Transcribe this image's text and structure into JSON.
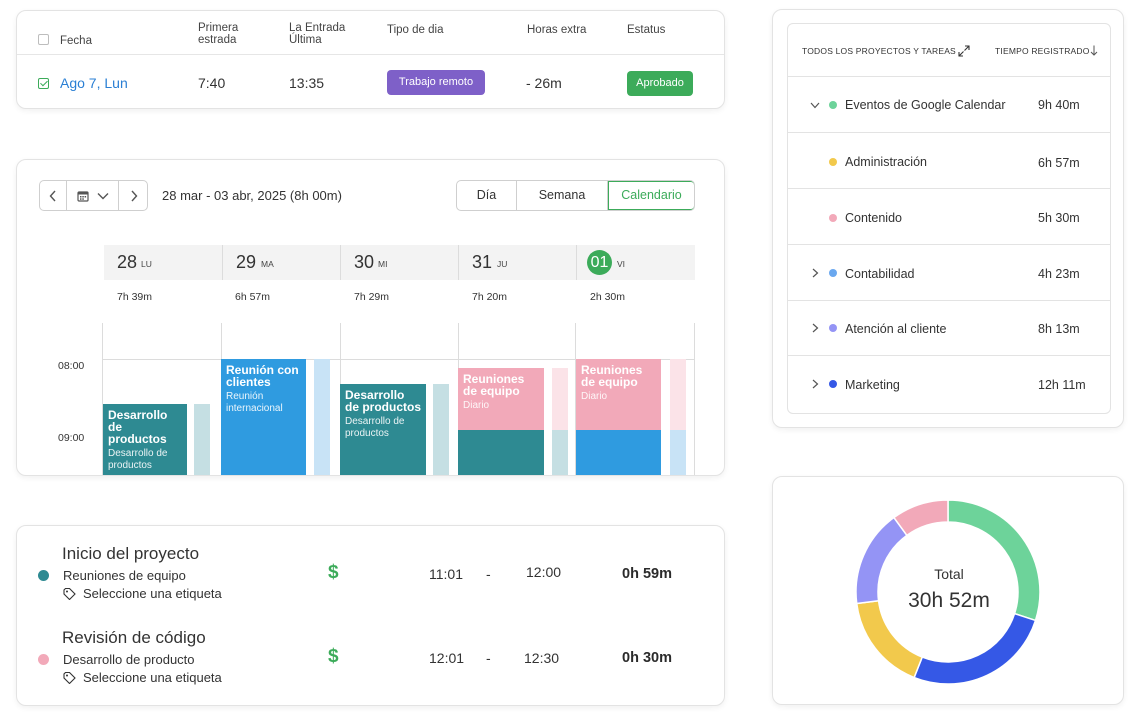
{
  "timesheet": {
    "headers": {
      "date": "Fecha",
      "first_entry_l1": "Primera",
      "first_entry_l2": "estrada",
      "last_entry_l1": "La Entrada",
      "last_entry_l2": "Última",
      "day_type": "Tipo de dia",
      "overtime": "Horas extra",
      "status": "Estatus"
    },
    "row": {
      "date": "Ago 7, Lun",
      "first_entry": "7:40",
      "last_entry": "13:35",
      "day_type": "Trabajo remoto",
      "overtime": "- 26m",
      "status": "Aprobado"
    },
    "colors": {
      "day_type": "#7e60c8",
      "status": "#3cab5a",
      "date_link": "#2a7fd4"
    }
  },
  "calendar": {
    "range": "28 mar - 03 abr, 2025 (8h 00m)",
    "icons": {
      "prev": "chevron-left-icon",
      "calendar": "calendar-icon",
      "dropdown": "chevron-down-icon",
      "next": "chevron-right-icon"
    },
    "views": [
      "Día",
      "Semana",
      "Calendario"
    ],
    "active_view": "Calendario",
    "time_labels": [
      "08:00",
      "09:00"
    ],
    "days": [
      {
        "num": "28",
        "abbr": "LU",
        "total": "7h 39m"
      },
      {
        "num": "29",
        "abbr": "MA",
        "total": "6h 57m"
      },
      {
        "num": "30",
        "abbr": "MI",
        "total": "7h 29m"
      },
      {
        "num": "31",
        "abbr": "JU",
        "total": "7h 20m"
      },
      {
        "num": "01",
        "abbr": "VI",
        "total": "2h 30m",
        "today": true
      }
    ],
    "events": [
      {
        "title": "Desarrollo de productos",
        "sub": "Desarrollo de productos"
      },
      {
        "title": "Reunión con clientes",
        "sub": "Reunión internacional"
      },
      {
        "title": "Desarrollo de productos",
        "sub": "Desarrollo de productos"
      },
      {
        "title": "Reuniones de equipo",
        "sub": "Diario"
      },
      {
        "title": "Reuniones de equipo",
        "sub": "Diario"
      }
    ],
    "colors": {
      "teal": "#2e8a92",
      "blue": "#2f9be0",
      "pink": "#f2a9b9",
      "today": "#3cab5a"
    }
  },
  "entries": [
    {
      "title": "Inicio del proyecto",
      "project": "Reuniones de equipo",
      "tag": "Seleccione una etiqueta",
      "start": "11:01",
      "sep": "-",
      "end": "12:00",
      "duration": "0h 59m",
      "dot_color": "#2e8a92",
      "billable": "$"
    },
    {
      "title": "Revisión de código",
      "project": "Desarrollo de producto",
      "tag": "Seleccione una etiqueta",
      "start": "12:01",
      "sep": "-",
      "end": "12:30",
      "duration": "0h 30m",
      "dot_color": "#f2a9b9",
      "billable": "$"
    }
  ],
  "projects": {
    "header_left": "TODOS LOS PROYECTOS Y TAREAS",
    "header_right": "TIEMPO REGISTRADO",
    "header_right_icon": "arrow-down-icon",
    "expand_icon": "expand-icon",
    "rows": [
      {
        "name": "Eventos de Google Calendar",
        "time": "9h 40m",
        "color": "#6dd39a",
        "chevron": "down"
      },
      {
        "name": "Administración",
        "time": "6h 57m",
        "color": "#f2c94c",
        "chevron": ""
      },
      {
        "name": "Contenido",
        "time": "5h 30m",
        "color": "#f2a9b9",
        "chevron": ""
      },
      {
        "name": "Contabilidad",
        "time": "4h 23m",
        "color": "#6aa8ef",
        "chevron": "right"
      },
      {
        "name": "Atención al cliente",
        "time": "8h 13m",
        "color": "#9494f5",
        "chevron": "right"
      },
      {
        "name": "Marketing",
        "time": "12h 11m",
        "color": "#3558e6",
        "chevron": "right"
      }
    ]
  },
  "donut": {
    "label": "Total",
    "value": "30h 52m",
    "segments": [
      {
        "color": "#6dd39a",
        "fraction": 0.3
      },
      {
        "color": "#3558e6",
        "fraction": 0.26
      },
      {
        "color": "#f2c94c",
        "fraction": 0.17
      },
      {
        "color": "#9494f5",
        "fraction": 0.17
      },
      {
        "color": "#f2a9b9",
        "fraction": 0.1
      }
    ]
  }
}
